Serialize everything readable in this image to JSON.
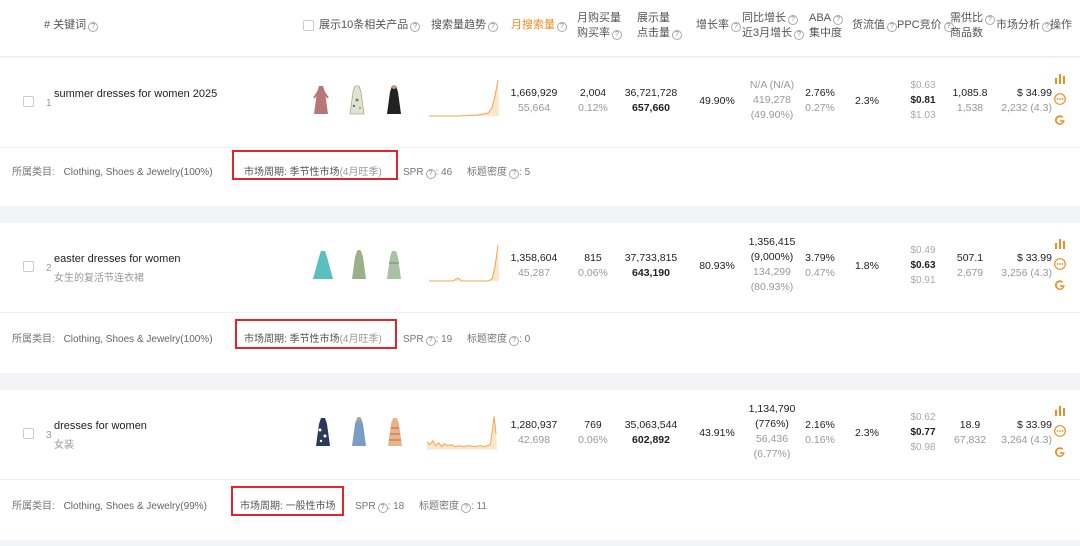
{
  "header": {
    "keyword_col": "# 关键词",
    "show_products": "展示10条相关产品",
    "search_trend": "搜索量趋势",
    "monthly_search": "月搜索量",
    "monthly_purchase_1": "月购买量",
    "monthly_purchase_2": "购买率",
    "impressions_1": "展示量",
    "impressions_2": "点击量",
    "growth": "增长率",
    "yoy_1": "同比增长",
    "yoy_2": "近3月增长",
    "aba_1": "ABA",
    "aba_2": "集中度",
    "goods_value": "货流值",
    "ppc": "PPC竞价",
    "supply_1": "需供比",
    "supply_2": "商品数",
    "market_analysis": "市场分析",
    "operation": "操作"
  },
  "rows": [
    {
      "index": "1",
      "keyword": "summer dresses for women 2025",
      "keyword_cn": "",
      "monthly_search": "1,669,929",
      "monthly_search_sub": "55,664",
      "purchase": "2,004",
      "purchase_rate": "0.12%",
      "impressions": "36,721,728",
      "clicks": "657,660",
      "growth": "49.90%",
      "yoy": "N/A (N/A)",
      "yoy_sub": "419,278",
      "yoy_sub2": "(49.90%)",
      "aba": "2.76%",
      "aba_sub": "0.27%",
      "goods_value": "2.3%",
      "ppc_low": "$0.63",
      "ppc_mid": "$0.81",
      "ppc_high": "$1.03",
      "supply_ratio": "1,085.8",
      "product_count": "1,538",
      "price": "$ 34.99",
      "reviews": "2,232 (4.3)",
      "category_label": "所属类目:",
      "category": "Clothing, Shoes & Jewelry",
      "category_pct": "(100%)",
      "cycle_label": "市场周期:",
      "cycle": "季节性市场",
      "cycle_note": "(4月旺季)",
      "spr_label": "SPR",
      "spr": ": 46",
      "title_density_label": "标题密度",
      "title_density": ": 5"
    },
    {
      "index": "2",
      "keyword": "easter dresses for women",
      "keyword_cn": "女生的复活节连衣裙",
      "monthly_search": "1,358,604",
      "monthly_search_sub": "45,287",
      "purchase": "815",
      "purchase_rate": "0.06%",
      "impressions": "37,733,815",
      "clicks": "643,190",
      "growth": "80.93%",
      "yoy": "1,356,415",
      "yoy_sub": "(9,000%)",
      "yoy_sub2": "134,299",
      "yoy_sub3": "(80.93%)",
      "aba": "3.79%",
      "aba_sub": "0.47%",
      "goods_value": "1.8%",
      "ppc_low": "$0.49",
      "ppc_mid": "$0.63",
      "ppc_high": "$0.91",
      "supply_ratio": "507.1",
      "product_count": "2,679",
      "price": "$ 33.99",
      "reviews": "3,256 (4.3)",
      "category_label": "所属类目:",
      "category": "Clothing, Shoes & Jewelry",
      "category_pct": "(100%)",
      "cycle_label": "市场周期:",
      "cycle": "季节性市场",
      "cycle_note": "(4月旺季)",
      "spr_label": "SPR",
      "spr": ": 19",
      "title_density_label": "标题密度",
      "title_density": ": 0"
    },
    {
      "index": "3",
      "keyword": "dresses for women",
      "keyword_cn": "女装",
      "monthly_search": "1,280,937",
      "monthly_search_sub": "42,698",
      "purchase": "769",
      "purchase_rate": "0.06%",
      "impressions": "35,063,544",
      "clicks": "602,892",
      "growth": "43.91%",
      "yoy": "1,134,790",
      "yoy_sub": "(776%)",
      "yoy_sub2": "56,436",
      "yoy_sub3": "(6.77%)",
      "aba": "2.16%",
      "aba_sub": "0.16%",
      "goods_value": "2.3%",
      "ppc_low": "$0.62",
      "ppc_mid": "$0.77",
      "ppc_high": "$0.98",
      "supply_ratio": "18.9",
      "product_count": "67,832",
      "price": "$ 33.99",
      "reviews": "3,264 (4.3)",
      "category_label": "所属类目:",
      "category": "Clothing, Shoes & Jewelry",
      "category_pct": "(99%)",
      "cycle_label": "市场周期:",
      "cycle": "一般性市场",
      "cycle_note": "",
      "spr_label": "SPR",
      "spr": ": 18",
      "title_density_label": "标题密度",
      "title_density": ": 11"
    }
  ],
  "colors": {
    "accent": "#f08c22",
    "highlight_box": "#e0262b",
    "sparkline": "#f5a54a"
  },
  "icons": [
    "question-icon",
    "bar-chart-icon",
    "more-icon",
    "google-icon",
    "checkbox-icon"
  ]
}
